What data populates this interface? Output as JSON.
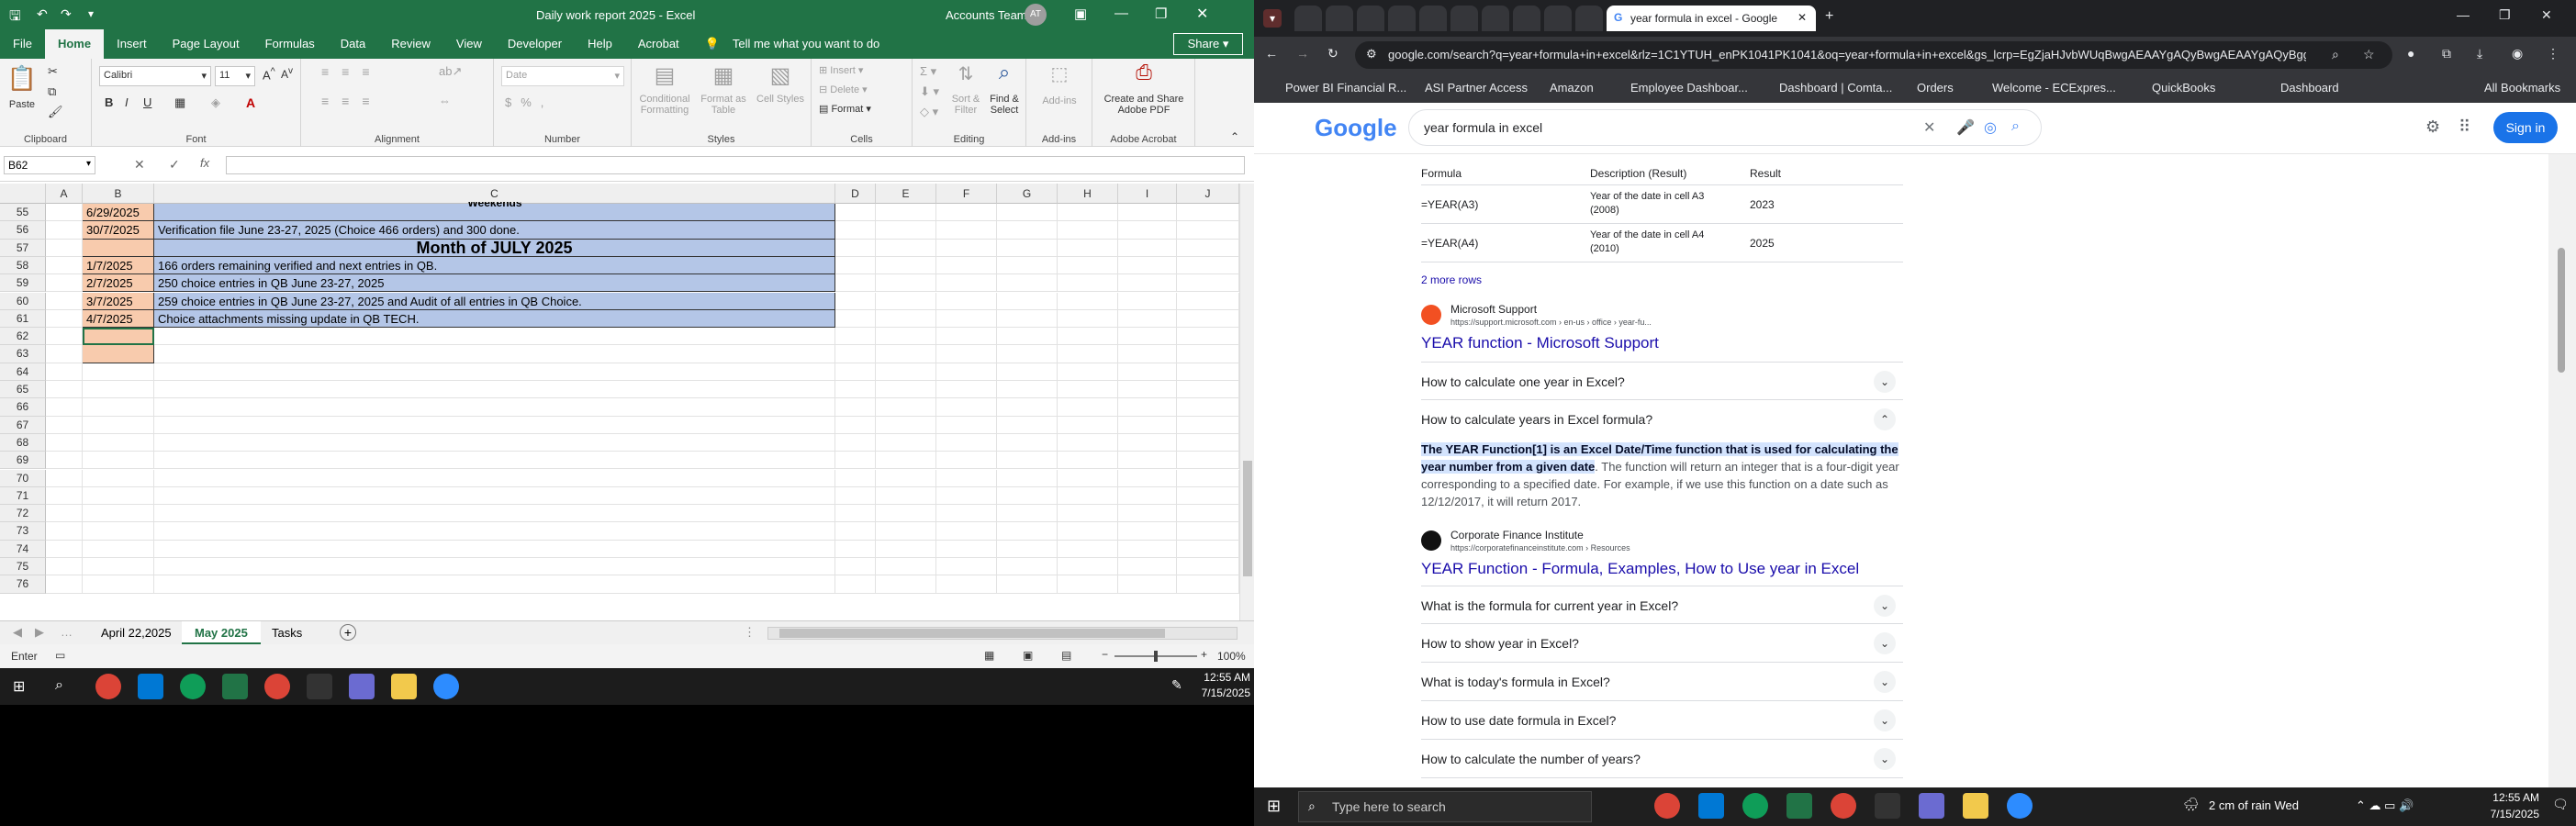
{
  "excel": {
    "title_text": "Daily work report 2025 - Excel",
    "account": "Accounts Team",
    "account_initials": "AT",
    "tabs": [
      "File",
      "Home",
      "Insert",
      "Page Layout",
      "Formulas",
      "Data",
      "Review",
      "View",
      "Developer",
      "Help",
      "Acrobat"
    ],
    "tell_me": "Tell me what you want to do",
    "share": "Share",
    "ribbon": {
      "paste": "Paste",
      "clipboard": "Clipboard",
      "font_name": "Calibri",
      "font_size": "11",
      "font": "Font",
      "alignment": "Alignment",
      "number_format": "Date",
      "number": "Number",
      "conditional": "Conditional Formatting",
      "format_as_table": "Format as Table",
      "cell_styles": "Cell Styles",
      "styles": "Styles",
      "insert": "Insert",
      "delete": "Delete",
      "format": "Format",
      "cells": "Cells",
      "sort_filter": "Sort & Filter",
      "find_select": "Find & Select",
      "editing": "Editing",
      "addins": "Add-ins",
      "addins_group": "Add-ins",
      "create_share": "Create and Share Adobe PDF",
      "adobe": "Adobe Acrobat"
    },
    "name_box": "B62",
    "formula": "",
    "columns": [
      "A",
      "B",
      "C",
      "D",
      "E",
      "F",
      "G",
      "H",
      "I",
      "J"
    ],
    "top_partial": "Weekends",
    "rows": [
      {
        "num": "55",
        "b": "6/29/2025",
        "c": ""
      },
      {
        "num": "56",
        "b": "30/7/2025",
        "c": "Verification file June 23-27, 2025 (Choice 466 orders) and 300 done."
      },
      {
        "num": "57",
        "b": "",
        "c": "Month of JULY 2025"
      },
      {
        "num": "58",
        "b": "1/7/2025",
        "c": "166 orders remaining verified and next entries in QB."
      },
      {
        "num": "59",
        "b": "2/7/2025",
        "c": "250 choice entries in QB June 23-27, 2025"
      },
      {
        "num": "60",
        "b": "3/7/2025",
        "c": "259 choice entries in QB June 23-27, 2025 and Audit of all entries in QB Choice."
      },
      {
        "num": "61",
        "b": "4/7/2025",
        "c": "Choice attachments missing update in QB TECH."
      },
      {
        "num": "62",
        "b": "",
        "c": ""
      },
      {
        "num": "63",
        "b": "",
        "c": ""
      },
      {
        "num": "64",
        "b": "",
        "c": ""
      },
      {
        "num": "65",
        "b": "",
        "c": ""
      },
      {
        "num": "66",
        "b": "",
        "c": ""
      },
      {
        "num": "67",
        "b": "",
        "c": ""
      },
      {
        "num": "68",
        "b": "",
        "c": ""
      },
      {
        "num": "69",
        "b": "",
        "c": ""
      },
      {
        "num": "70",
        "b": "",
        "c": ""
      },
      {
        "num": "71",
        "b": "",
        "c": ""
      },
      {
        "num": "72",
        "b": "",
        "c": ""
      },
      {
        "num": "73",
        "b": "",
        "c": ""
      },
      {
        "num": "74",
        "b": "",
        "c": ""
      },
      {
        "num": "75",
        "b": "",
        "c": ""
      },
      {
        "num": "76",
        "b": "",
        "c": ""
      }
    ],
    "sheets": [
      "April 22,2025",
      "May 2025",
      "Tasks"
    ],
    "active_sheet": "May 2025",
    "status_mode": "Enter",
    "zoom": "100%",
    "time": "12:55 AM",
    "date": "7/15/2025"
  },
  "chrome": {
    "active_tab_title": "year formula in excel - Google",
    "url": "google.com/search?q=year+formula+in+excel&rlz=1C1YTUH_enPK1041PK1041&oq=year+formula+in+excel&gs_lcrp=EgZjaHJvbWUqBwgAEAAYgAQyBwgAEAAYgAQyBggBE...",
    "bookmarks": [
      "Power BI Financial R...",
      "ASI Partner Access",
      "Amazon",
      "Employee Dashboar...",
      "Dashboard | Comta...",
      "Orders",
      "Welcome - ECExpres...",
      "QuickBooks",
      "Dashboard",
      "All Bookmarks"
    ],
    "search_query": "year formula in excel",
    "sign_in": "Sign in",
    "table": {
      "headers": [
        "Formula",
        "Description (Result)",
        "Result"
      ],
      "rows": [
        {
          "f": "=YEAR(A3)",
          "d1": "Year of the date in cell A3",
          "d2": "(2008)",
          "r": "2023"
        },
        {
          "f": "=YEAR(A4)",
          "d1": "Year of the date in cell A4",
          "d2": "(2010)",
          "r": "2025"
        }
      ],
      "more": "2 more rows"
    },
    "result1": {
      "site": "Microsoft Support",
      "url": "https://support.microsoft.com › en-us › office › year-fu...",
      "title": "YEAR function - Microsoft Support"
    },
    "questions_top": [
      "How to calculate one year in Excel?",
      "How to calculate years in Excel formula?"
    ],
    "snippet_highlight": "The YEAR Function[1] is an Excel Date/Time function that is used for calculating the year number from a given date",
    "snippet_rest": ". The function will return an integer that is a four-digit year corresponding to a specified date. For example, if we use this function on a date such as 12/12/2017, it will return 2017.",
    "result2": {
      "site": "Corporate Finance Institute",
      "url": "https://corporatefinanceinstitute.com › Resources",
      "title": "YEAR Function - Formula, Examples, How to Use year in Excel"
    },
    "questions_bottom": [
      "What is the formula for current year in Excel?",
      "How to show year in Excel?",
      "What is today's formula in Excel?",
      "How to use date formula in Excel?",
      "How to calculate the number of years?"
    ]
  },
  "win_taskbar": {
    "search_placeholder": "Type here to search",
    "weather": "2 cm of rain Wed",
    "time": "12:55 AM",
    "date": "7/15/2025"
  },
  "colors": {
    "excel_green": "#217346",
    "cell_orange": "#f8cbad",
    "cell_blue": "#b4c6e7",
    "google_blue": "#1a0dab",
    "chrome_dark": "#202124"
  }
}
